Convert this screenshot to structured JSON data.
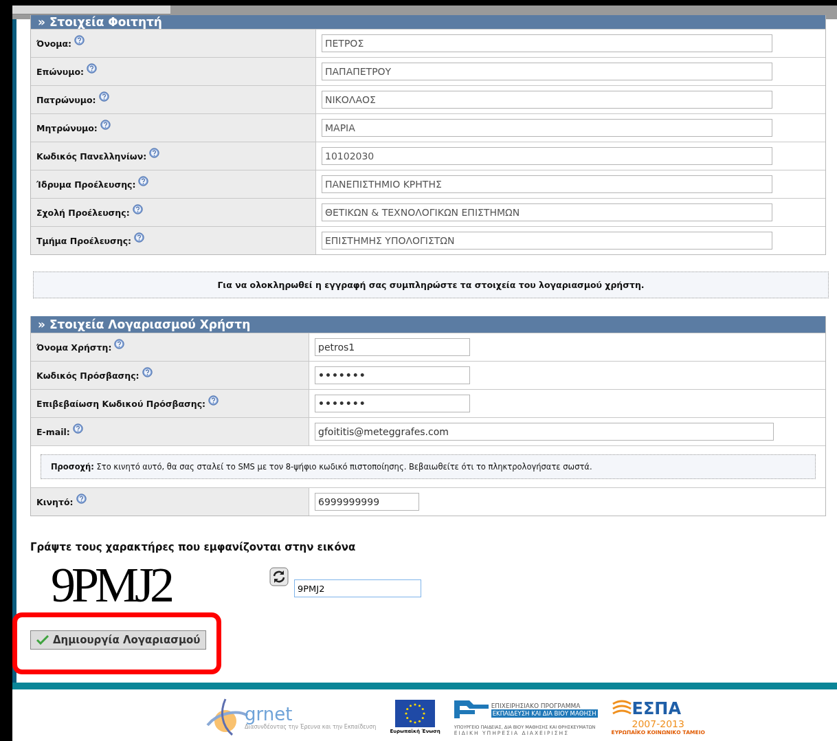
{
  "student_section": {
    "title": "» Στοιχεία Φοιτητή",
    "fields": [
      {
        "label": "Όνομα:",
        "value": "ΠΕΤΡΟΣ"
      },
      {
        "label": "Επώνυμο:",
        "value": "ΠΑΠΑΠΕΤΡΟΥ"
      },
      {
        "label": "Πατρώνυμο:",
        "value": "ΝΙΚΟΛΑΟΣ"
      },
      {
        "label": "Μητρώνυμο:",
        "value": "ΜΑΡΙΑ"
      },
      {
        "label": "Κωδικός Πανελληνίων:",
        "value": "10102030"
      },
      {
        "label": "Ίδρυμα Προέλευσης:",
        "value": "ΠΑΝΕΠΙΣΤΗΜΙΟ ΚΡΗΤΗΣ"
      },
      {
        "label": "Σχολή Προέλευσης:",
        "value": "ΘΕΤΙΚΩΝ & ΤΕΧΝΟΛΟΓΙΚΩΝ ΕΠΙΣΤΗΜΩΝ"
      },
      {
        "label": "Τμήμα Προέλευσης:",
        "value": "ΕΠΙΣΤΗΜΗΣ ΥΠΟΛΟΓΙΣΤΩΝ"
      }
    ]
  },
  "info_note": "Για να ολοκληρωθεί η εγγραφή σας συμπληρώστε τα στοιχεία του λογαριασμού χρήστη.",
  "account_section": {
    "title": "» Στοιχεία Λογαριασμού Χρήστη",
    "rows": [
      {
        "kind": "field",
        "label": "Όνομα Χρήστη:",
        "value": "petros1"
      },
      {
        "kind": "password",
        "label": "Κωδικός Πρόσβασης:",
        "value": "•••••••"
      },
      {
        "kind": "password",
        "label": "Επιβεβαίωση Κωδικού Πρόσβασης:",
        "value": "•••••••"
      },
      {
        "kind": "email",
        "label": "E-mail:",
        "value": "gfoititis@meteggrafes.com"
      },
      {
        "kind": "note",
        "text": "**Προσοχή:** Στο κινητό αυτό, θα σας σταλεί το SMS με τον 8-ψήφιο κωδικό πιστοποίησης. Βεβαιωθείτε ότι το πληκτρολογήσατε σωστά."
      },
      {
        "kind": "phone",
        "label": "Κινητό:",
        "value": "6999999999"
      }
    ]
  },
  "captcha": {
    "prompt": "Γράψτε τους χαρακτήρες που εμφανίζονται στην εικόνα",
    "image_text": "9PMJ2",
    "value": "9PMJ2"
  },
  "submit_button": {
    "label": "Δημιουργία Λογαριασμού",
    "highlighted": true
  },
  "footer": {
    "grnet": {
      "name": "grnet",
      "tagline": "Διασυνδέοντας την Έρευνα και την Εκπαίδευση"
    },
    "eu": {
      "caption": "Ευρωπαϊκή Ένωση"
    },
    "programme": {
      "line1": "ΕΠΙΧΕΙΡΗΣΙΑΚΟ ΠΡΟΓΡΑΜΜΑ",
      "line2": "ΕΚΠΑΙΔΕΥΣΗ ΚΑΙ ΔΙΑ ΒΙΟΥ ΜΑΘΗΣΗ",
      "ministry": "ΥΠΟΥΡΓΕΙΟ ΠΑΙΔΕΙΑΣ, ΔΙΑ ΒΙΟΥ ΜΑΘΗΣΗΣ ΚΑΙ ΘΡΗΣΚΕΥΜΑΤΩΝ",
      "service": "ΕΙΔΙΚΗ ΥΠΗΡΕΣΙΑ ΔΙΑΧΕΙΡΙΣΗΣ"
    },
    "espa": {
      "name": "ΕΣΠΑ",
      "years": "2007-2013",
      "fund": "ΕΥΡΩΠΑΪΚΟ ΚΟΙΝΩΝΙΚΟ ΤΑΜΕΙΟ"
    }
  }
}
